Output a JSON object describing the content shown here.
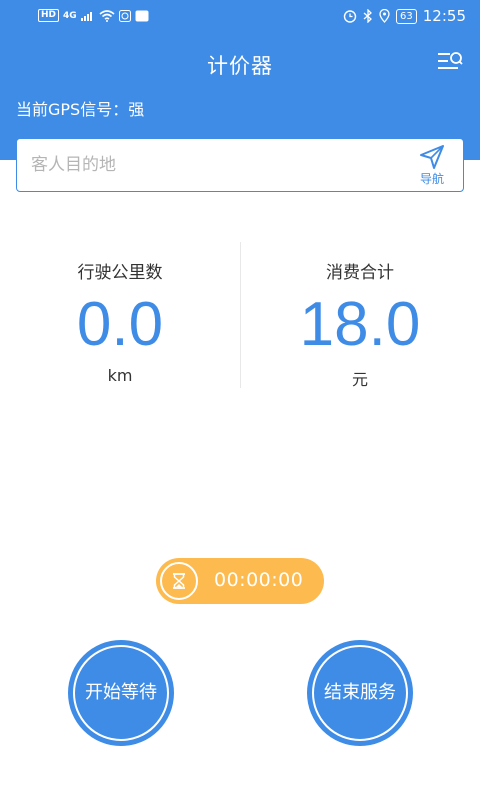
{
  "status_bar": {
    "indicators": [
      "HD",
      "4G"
    ],
    "battery": "63",
    "time": "12:55",
    "icons": [
      "signal-icon",
      "wifi-icon",
      "alarm-icon",
      "bluetooth-icon",
      "location-icon"
    ]
  },
  "header": {
    "title": "计价器",
    "gps_text": "当前GPS信号：强",
    "menu_icon": "list-search-icon"
  },
  "search": {
    "placeholder": "客人目的地",
    "value": "",
    "nav_label": "导航",
    "nav_icon": "navigation-arrow-icon"
  },
  "stats": {
    "distance": {
      "label": "行驶公里数",
      "value": "0.0",
      "unit": "km"
    },
    "fare": {
      "label": "消费合计",
      "value": "18.0",
      "unit": "元"
    }
  },
  "timer": {
    "icon": "hourglass-icon",
    "value": "00:00:00"
  },
  "buttons": {
    "start_wait": "开始等待",
    "end_service": "结束服务"
  },
  "colors": {
    "primary": "#3f8ce6",
    "timer_bg": "#fdba4f",
    "text": "#333333"
  }
}
